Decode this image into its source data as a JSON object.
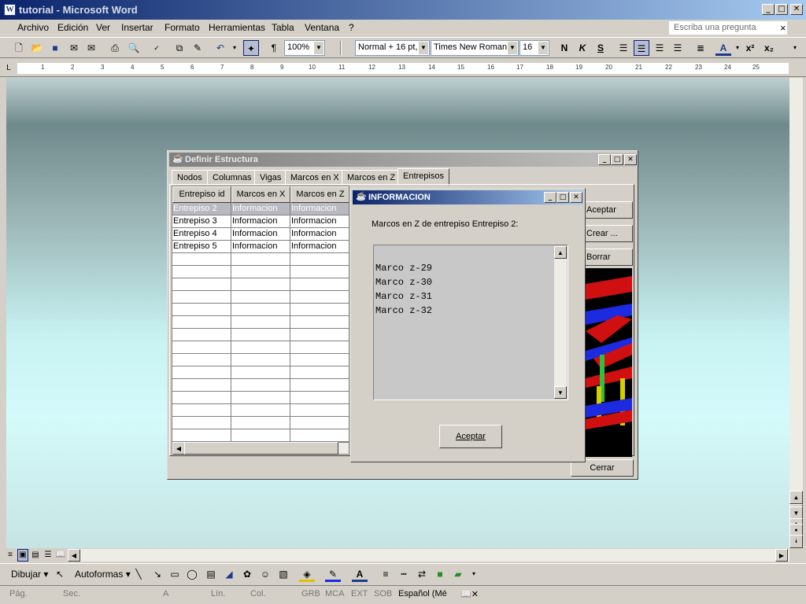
{
  "window": {
    "title": "tutorial - Microsoft Word",
    "icon": "W"
  },
  "menu": {
    "items": [
      "Archivo",
      "Edición",
      "Ver",
      "Insertar",
      "Formato",
      "Herramientas",
      "Tabla",
      "Ventana",
      "?"
    ],
    "ask_placeholder": "Escriba una pregunta"
  },
  "toolbar": {
    "zoom": "100%",
    "style": "Normal + 16 pt,",
    "font": "Times New Roman",
    "size": "16",
    "bold": "N",
    "italic": "K",
    "underline": "S",
    "pilcrow": "¶"
  },
  "ruler": {
    "ticks": [
      "1",
      "2",
      "3",
      "4",
      "5",
      "6",
      "7",
      "8",
      "9",
      "10",
      "11",
      "12",
      "13",
      "14",
      "15",
      "16",
      "17",
      "18",
      "19",
      "20",
      "21",
      "22",
      "23",
      "24",
      "25"
    ]
  },
  "define_dialog": {
    "title": "Definir Estructura",
    "tabs": [
      "Nodos",
      "Columnas",
      "Vigas",
      "Marcos en X",
      "Marcos en Z",
      "Entrepisos"
    ],
    "selected_tab": "Entrepisos",
    "columns": [
      "Entrepiso id",
      "Marcos en X",
      "Marcos en Z"
    ],
    "rows": [
      [
        "Entrepiso 2",
        "Informacion",
        "Informacion"
      ],
      [
        "Entrepiso 3",
        "Informacion",
        "Informacion"
      ],
      [
        "Entrepiso 4",
        "Informacion",
        "Informacion"
      ],
      [
        "Entrepiso 5",
        "Informacion",
        "Informacion"
      ]
    ],
    "selected_row": 0,
    "buttons": {
      "aceptar": "Aceptar",
      "crear": "Crear ...",
      "borrar": "Borrar",
      "cerrar": "Cerrar"
    }
  },
  "info_dialog": {
    "title": "INFORMACION",
    "message": "Marcos en Z de entrepiso Entrepiso 2:",
    "lines": [
      "Marco z-29",
      "Marco z-30",
      "Marco z-31",
      "Marco z-32"
    ],
    "ok": "Aceptar"
  },
  "drawbar": {
    "draw": "Dibujar",
    "autoshapes": "Autoformas"
  },
  "status": {
    "page": "Pág.",
    "sec": "Sec.",
    "a": "A",
    "lin": "Lín.",
    "col": "Col.",
    "grb": "GRB",
    "mca": "MCA",
    "ext": "EXT",
    "sob": "SOB",
    "lang": "Español (Mé"
  }
}
